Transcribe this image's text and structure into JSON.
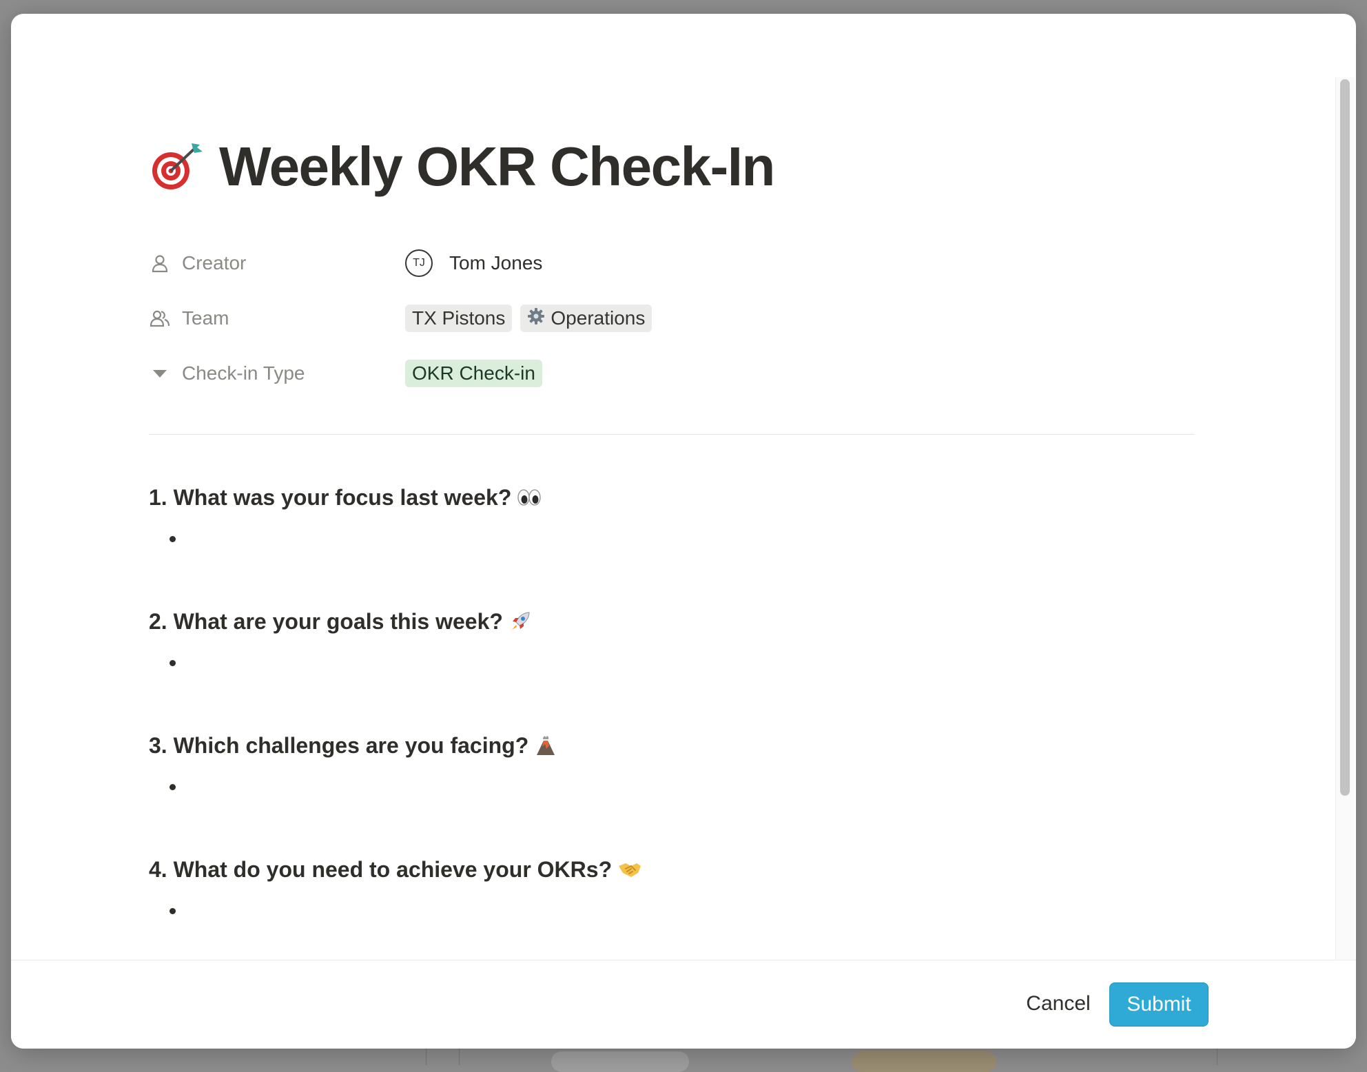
{
  "page": {
    "title": "Weekly OKR Check-In",
    "title_icon": "target-dart-icon"
  },
  "properties": {
    "creator": {
      "label": "Creator",
      "icon": "person-icon",
      "avatar_initials": "TJ",
      "value": "Tom Jones"
    },
    "team": {
      "label": "Team",
      "icon": "people-icon",
      "tags": [
        {
          "label": "TX Pistons",
          "icon": ""
        },
        {
          "label": "Operations",
          "icon": "gear-icon"
        }
      ]
    },
    "checkin_type": {
      "label": "Check-in Type",
      "icon": "triangle-down-icon",
      "value": "OKR Check-in",
      "color": "#dbeddb"
    }
  },
  "questions": [
    {
      "text": "1. What was your focus last week?",
      "emoji": "eyes-icon"
    },
    {
      "text": "2. What are your goals this week?",
      "emoji": "rocket-icon"
    },
    {
      "text": "3. Which challenges are you facing?",
      "emoji": "volcano-icon"
    },
    {
      "text": "4. What do you need to achieve your OKRs?",
      "emoji": "handshake-icon"
    }
  ],
  "footer": {
    "cancel_label": "Cancel",
    "submit_label": "Submit",
    "submit_color": "#2fa9d6"
  }
}
